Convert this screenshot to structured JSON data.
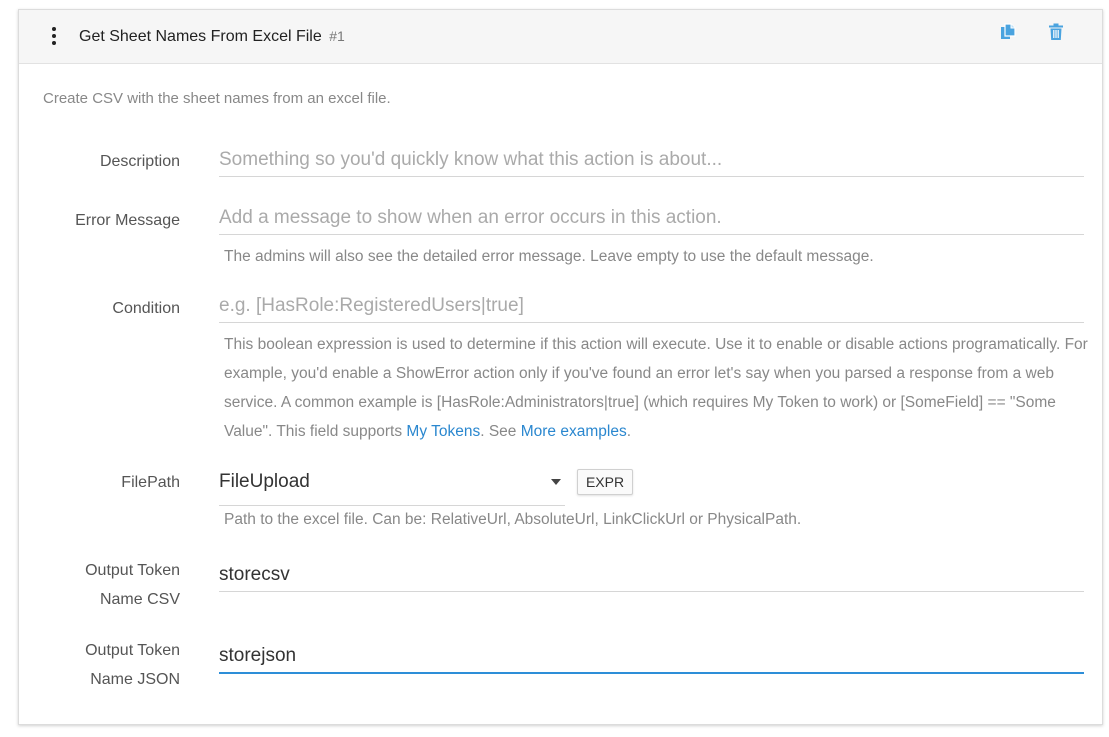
{
  "header": {
    "title": "Get Sheet Names From Excel File",
    "number": "#1",
    "copy_icon": "copy-icon",
    "trash_icon": "trash-icon",
    "icon_color": "#4aa3df"
  },
  "intro": "Create CSV with the sheet names from an excel file.",
  "fields": {
    "description": {
      "label": "Description",
      "placeholder": "Something so you'd quickly know what this action is about..."
    },
    "error_message": {
      "label": "Error Message",
      "placeholder": "Add a message to show when an error occurs in this action.",
      "help": "The admins will also see the detailed error message. Leave empty to use the default message."
    },
    "condition": {
      "label": "Condition",
      "placeholder": "e.g. [HasRole:RegisteredUsers|true]",
      "help_text": "This boolean expression is used to determine if this action will execute. Use it to enable or disable actions programatically. For example, you'd enable a ShowError action only if you've found an error let's say when you parsed a response from a web service. A common example is [HasRole:Administrators|true] (which requires My Token to work) or [SomeField] == \"Some Value\". This field supports ",
      "link_tokens": "My Tokens",
      "help_mid": ". See ",
      "link_examples": "More examples",
      "help_end": "."
    },
    "filepath": {
      "label": "FilePath",
      "selected": "FileUpload",
      "expr_label": "EXPR",
      "help": "Path to the excel file. Can be: RelativeUrl, AbsoluteUrl, LinkClickUrl or PhysicalPath."
    },
    "output_csv": {
      "label_line1": "Output Token",
      "label_line2": "Name CSV",
      "value": "storecsv"
    },
    "output_json": {
      "label_line1": "Output Token",
      "label_line2": "Name JSON",
      "value": "storejson"
    }
  },
  "colors": {
    "accent": "#2d8ed8",
    "link": "#2a87cf"
  }
}
